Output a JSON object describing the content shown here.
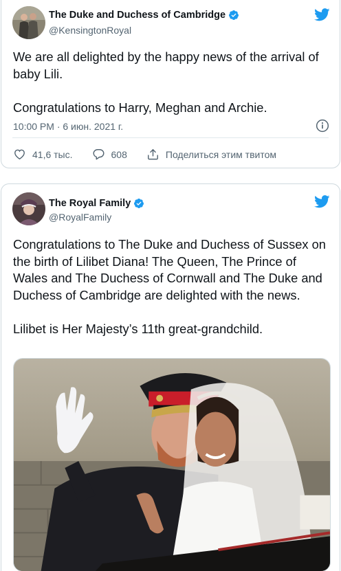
{
  "tweet1": {
    "author_name": "The Duke and Duchess of Cambridge",
    "author_handle": "@KensingtonRoyal",
    "text_lines": [
      "We are all delighted by the happy news of the arrival of baby Lili.",
      "Congratulations to Harry, Meghan and Archie."
    ],
    "timestamp": "10:00 PM · 6 июн. 2021 г.",
    "likes": "41,6 тыс.",
    "replies": "608",
    "share_label": "Поделиться этим твитом"
  },
  "tweet2": {
    "author_name": "The Royal Family",
    "author_handle": "@RoyalFamily",
    "text_lines": [
      "Congratulations to The Duke and Duchess of Sussex on the birth of Lilibet Diana! The Queen, The Prince of Wales and The Duchess of Cornwall and The Duke and Duchess of Cambridge are delighted with the news.",
      "Lilibet is Her Majesty’s 11th great-grandchild."
    ]
  },
  "icons": {
    "verified": "verified-badge-icon",
    "twitter": "twitter-bird-icon",
    "info": "info-icon",
    "like": "heart-icon",
    "reply": "reply-bubble-icon",
    "share": "share-icon"
  },
  "colors": {
    "twitter_blue": "#1d9bf0",
    "text_primary": "#0f1419",
    "text_secondary": "#536471",
    "border": "#cfd9de"
  }
}
